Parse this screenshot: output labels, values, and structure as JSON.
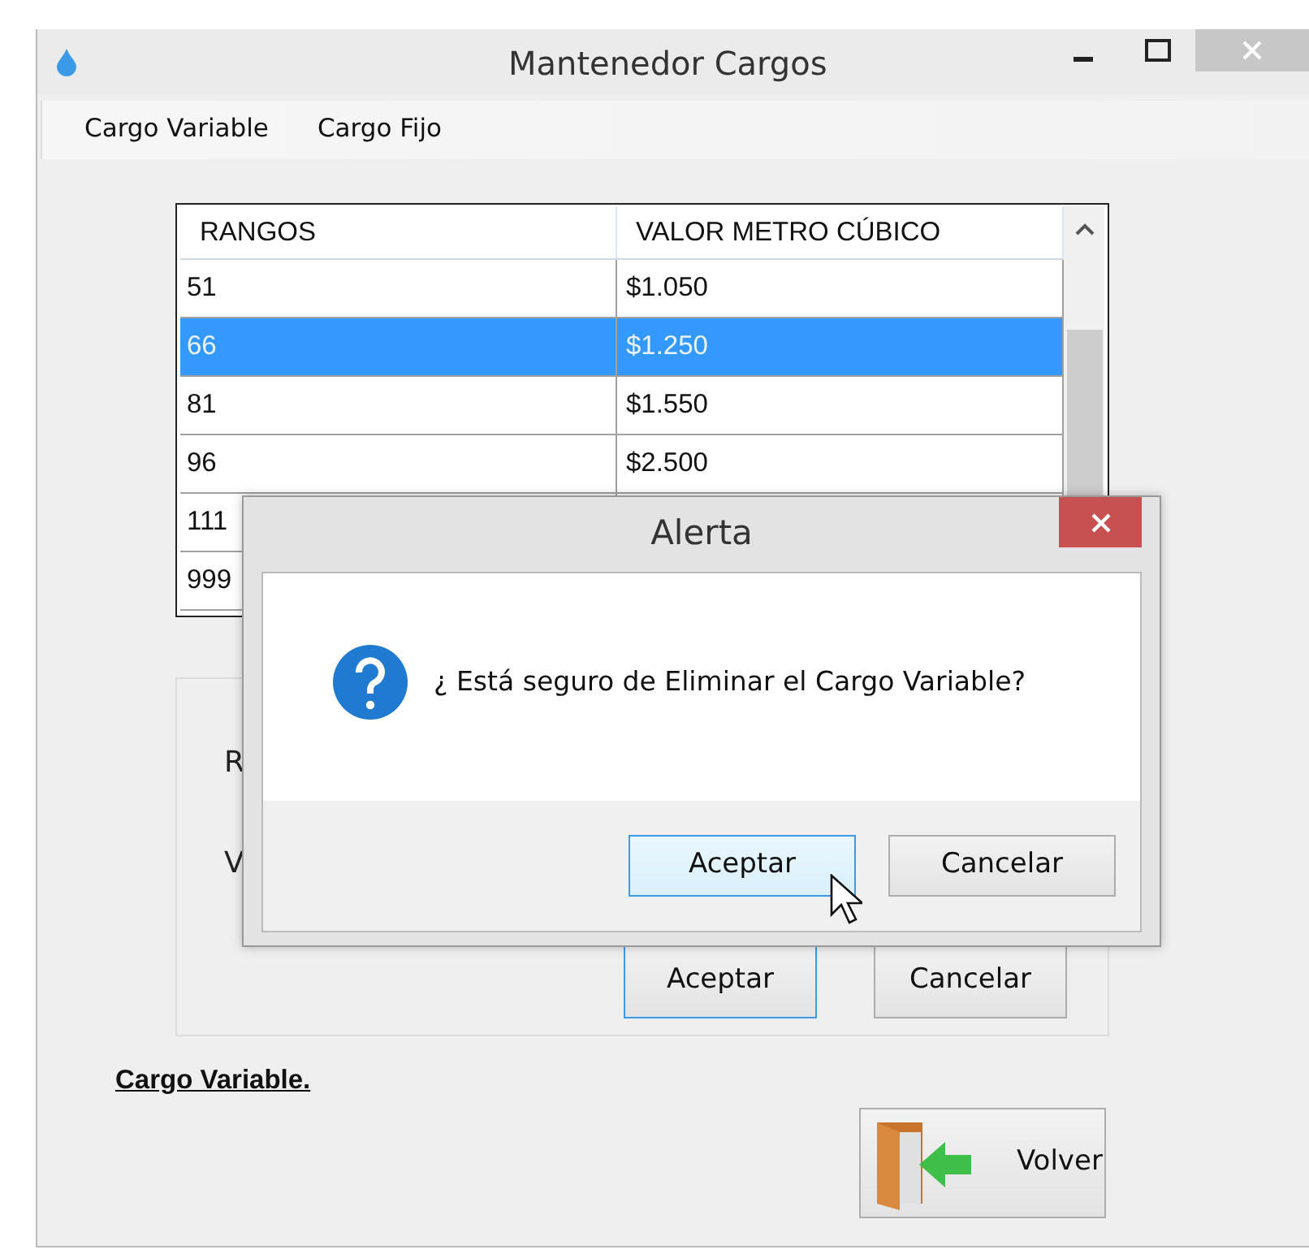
{
  "window": {
    "title": "Mantenedor Cargos"
  },
  "menu": [
    {
      "label": "Cargo Variable"
    },
    {
      "label": "Cargo Fijo"
    }
  ],
  "table": {
    "columns": [
      "RANGOS",
      "VALOR METRO CÚBICO"
    ],
    "rows": [
      {
        "cells": [
          "51",
          "$1.050"
        ],
        "selected": false
      },
      {
        "cells": [
          "66",
          "$1.250"
        ],
        "selected": true
      },
      {
        "cells": [
          "81",
          "$1.550"
        ],
        "selected": false
      },
      {
        "cells": [
          "96",
          "$2.500"
        ],
        "selected": false
      },
      {
        "cells": [
          "111"
        ],
        "selected": false
      },
      {
        "cells": [
          "999"
        ],
        "selected": false
      }
    ]
  },
  "form": {
    "labels": [
      "R",
      "V"
    ],
    "buttons": [
      {
        "label": "Aceptar",
        "focused": true
      },
      {
        "label": "Cancelar",
        "focused": false
      }
    ]
  },
  "section_label": "Cargo Variable.",
  "back_button": {
    "label": "Volver"
  },
  "dialog": {
    "title": "Alerta",
    "message": "¿ Está seguro de Eliminar el Cargo Variable?",
    "buttons": [
      {
        "label": "Aceptar",
        "focused": true
      },
      {
        "label": "Cancelar",
        "focused": false
      }
    ]
  }
}
